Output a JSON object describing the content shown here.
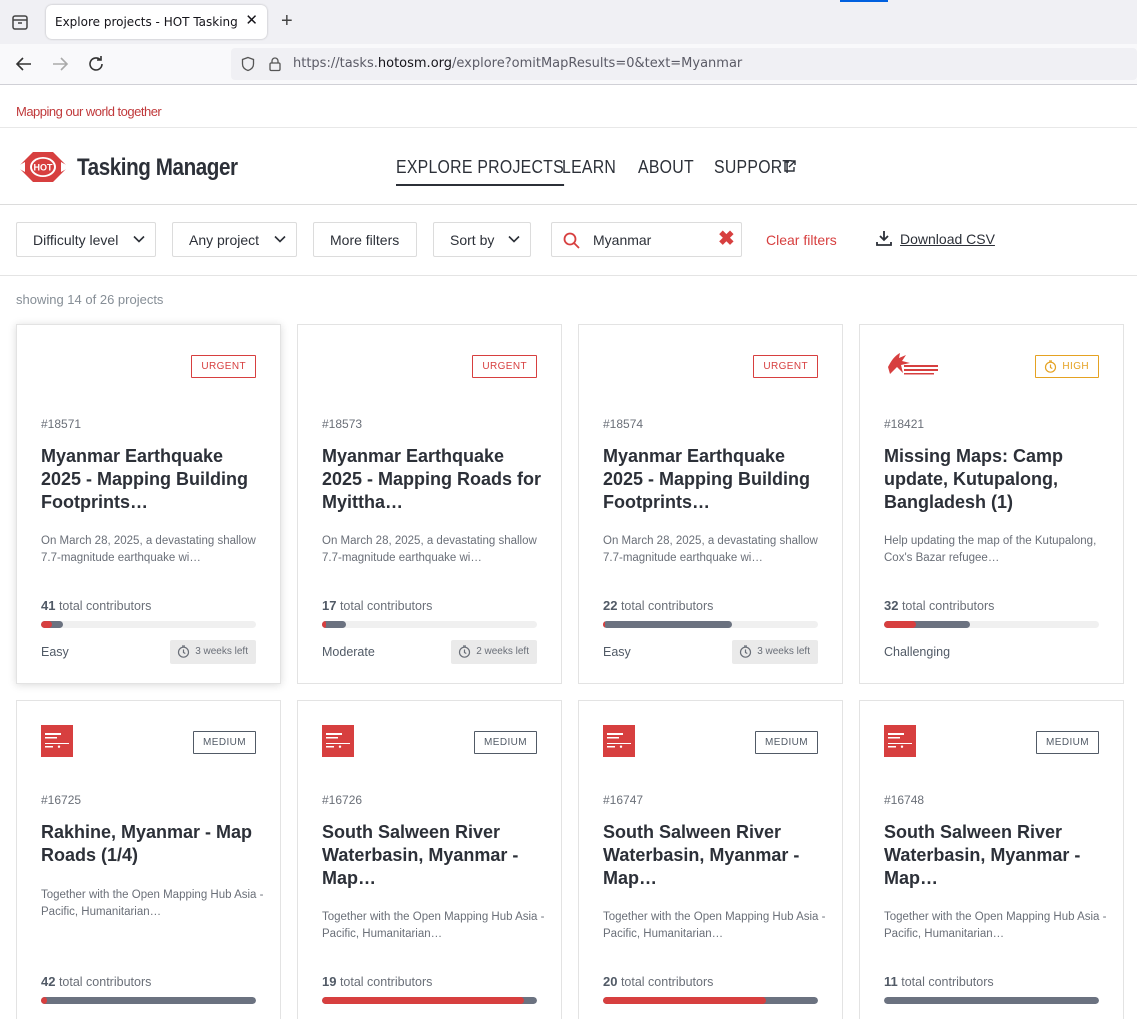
{
  "browser": {
    "tab_title": "Explore projects - HOT Tasking Manager",
    "close_glyph": "✕",
    "newtab_glyph": "+",
    "url_prefix": "https://tasks.",
    "url_domain": "hotosm.org",
    "url_suffix": "/explore?omitMapResults=0&text=Myanmar"
  },
  "site": {
    "tagline": "Mapping our world together",
    "brand": "Tasking Manager",
    "logo_text": "HOT",
    "nav": [
      "EXPLORE PROJECTS",
      "LEARN",
      "ABOUT",
      "SUPPORT"
    ]
  },
  "filters": {
    "difficulty": "Difficulty level",
    "project": "Any project",
    "more": "More filters",
    "sort": "Sort by",
    "search_value": "Myanmar",
    "clear_glyph": "✖",
    "clear_filters": "Clear filters",
    "download": "Download CSV"
  },
  "results": {
    "showing": "showing 14 of 26 projects"
  },
  "colors": {
    "accent": "#d73f3f",
    "high": "#e5a222",
    "validated": "#6b7280"
  },
  "projects": [
    {
      "id": "#18571",
      "priority": "URGENT",
      "title": "Myanmar Earthquake 2025 - Mapping Building Footprints…",
      "desc": "On March 28, 2025, a devastating shallow 7.7-magnitude earthquake wi…",
      "contributors": "41",
      "contributors_label": "total contributors",
      "mapped": 0.05,
      "validated": 0.1,
      "difficulty": "Easy",
      "time_left": "3 weeks left",
      "logo": "none"
    },
    {
      "id": "#18573",
      "priority": "URGENT",
      "title": "Myanmar Earthquake 2025 - Mapping Roads for Myittha…",
      "desc": "On March 28, 2025, a devastating shallow 7.7-magnitude earthquake wi…",
      "contributors": "17",
      "contributors_label": "total contributors",
      "mapped": 0.02,
      "validated": 0.11,
      "difficulty": "Moderate",
      "time_left": "2 weeks left",
      "logo": "none"
    },
    {
      "id": "#18574",
      "priority": "URGENT",
      "title": "Myanmar Earthquake 2025 - Mapping Building Footprints…",
      "desc": "On March 28, 2025, a devastating shallow 7.7-magnitude earthquake wi…",
      "contributors": "22",
      "contributors_label": "total contributors",
      "mapped": 0.01,
      "validated": 0.6,
      "difficulty": "Easy",
      "time_left": "3 weeks left",
      "logo": "none"
    },
    {
      "id": "#18421",
      "priority": "HIGH",
      "title": "Missing Maps: Camp update, Kutupalong, Bangladesh (1)",
      "desc": "Help updating the map of the Kutupalong, Cox's Bazar refugee…",
      "contributors": "32",
      "contributors_label": "total contributors",
      "mapped": 0.15,
      "validated": 0.4,
      "difficulty": "Challenging",
      "time_left": "",
      "logo": "msf"
    },
    {
      "id": "#16725",
      "priority": "MEDIUM",
      "title": "Rakhine, Myanmar - Map Roads (1/4)",
      "desc": "Together with the Open Mapping Hub Asia - Pacific, Humanitarian…",
      "contributors": "42",
      "contributors_label": "total contributors",
      "mapped": 0.03,
      "validated": 1.0,
      "difficulty": "",
      "time_left": "",
      "logo": "ohm"
    },
    {
      "id": "#16726",
      "priority": "MEDIUM",
      "title": "South Salween River Waterbasin, Myanmar - Map…",
      "desc": "Together with the Open Mapping Hub Asia - Pacific, Humanitarian…",
      "contributors": "19",
      "contributors_label": "total contributors",
      "mapped": 0.94,
      "validated": 1.0,
      "difficulty": "",
      "time_left": "",
      "logo": "ohm"
    },
    {
      "id": "#16747",
      "priority": "MEDIUM",
      "title": "South Salween River Waterbasin, Myanmar - Map…",
      "desc": "Together with the Open Mapping Hub Asia - Pacific, Humanitarian…",
      "contributors": "20",
      "contributors_label": "total contributors",
      "mapped": 0.76,
      "validated": 1.0,
      "difficulty": "",
      "time_left": "",
      "logo": "ohm"
    },
    {
      "id": "#16748",
      "priority": "MEDIUM",
      "title": "South Salween River Waterbasin, Myanmar - Map…",
      "desc": "Together with the Open Mapping Hub Asia - Pacific, Humanitarian…",
      "contributors": "11",
      "contributors_label": "total contributors",
      "mapped": 0.0,
      "validated": 1.0,
      "difficulty": "",
      "time_left": "",
      "logo": "ohm"
    }
  ]
}
